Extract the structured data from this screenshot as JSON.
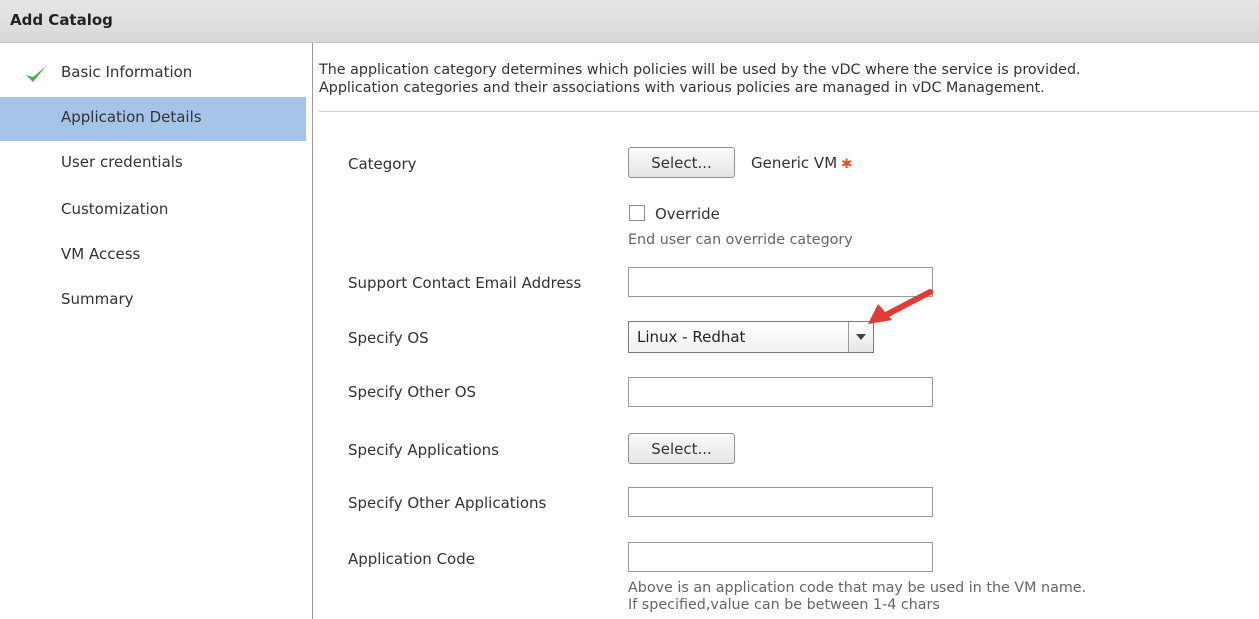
{
  "window": {
    "title": "Add Catalog"
  },
  "sidebar": {
    "items": [
      {
        "label": "Basic Information",
        "completed": true
      },
      {
        "label": "Application Details",
        "active": true
      },
      {
        "label": "User credentials"
      },
      {
        "label": "Customization"
      },
      {
        "label": "VM Access"
      },
      {
        "label": "Summary"
      }
    ]
  },
  "description": {
    "line1": "The application category determines which policies will be used by the vDC where the service is provided.",
    "line2": "Application categories and their associations with various policies are managed in vDC Management."
  },
  "form": {
    "category": {
      "label": "Category",
      "button": "Select...",
      "value": "Generic VM",
      "required_icon": "asterisk-icon"
    },
    "override": {
      "label": "Override",
      "checked": false,
      "hint": "End user can override category"
    },
    "support_email": {
      "label": "Support Contact Email Address",
      "value": ""
    },
    "specify_os": {
      "label": "Specify OS",
      "value": "Linux - Redhat"
    },
    "specify_other_os": {
      "label": "Specify Other OS",
      "value": ""
    },
    "specify_apps": {
      "label": "Specify Applications",
      "button": "Select..."
    },
    "specify_other_apps": {
      "label": "Specify Other Applications",
      "value": ""
    },
    "app_code": {
      "label": "Application Code",
      "value": "",
      "hint1": "Above is an application code that may be used in the VM name.",
      "hint2": "If specified,value can be between 1-4 chars"
    }
  },
  "colors": {
    "active_nav": "#a6c3e8",
    "check": "#4caf50",
    "annotation_arrow": "#e53935",
    "required": "#f04a1a"
  },
  "icons": {
    "completed": "check-icon",
    "dropdown": "chevron-down-icon",
    "annotation": "red-arrow-icon"
  }
}
